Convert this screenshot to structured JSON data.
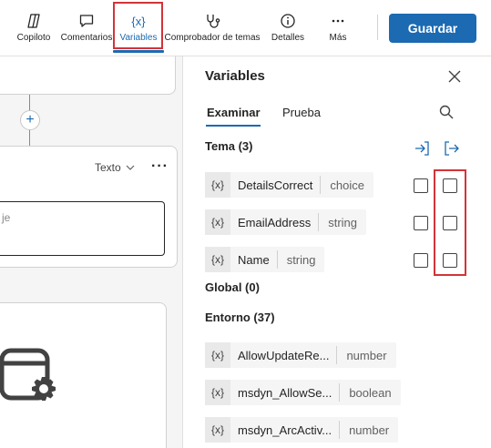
{
  "toolbar": {
    "items": [
      {
        "label": "Copiloto",
        "icon": "copilot-icon"
      },
      {
        "label": "Comentarios",
        "icon": "comment-icon"
      },
      {
        "label": "Variables",
        "icon": "variables-icon",
        "active": true
      },
      {
        "label": "Comprobador de temas",
        "icon": "stethoscope-icon"
      },
      {
        "label": "Detalles",
        "icon": "info-icon"
      },
      {
        "label": "Más",
        "icon": "more-icon"
      }
    ],
    "variables_icon_text": "{x}",
    "save_label": "Guardar"
  },
  "canvas": {
    "format_dropdown": "Texto",
    "message_placeholder": "je"
  },
  "panel": {
    "title": "Variables",
    "tabs": [
      "Examinar",
      "Prueba"
    ],
    "active_tab": "Examinar",
    "topic_section": "Tema (3)",
    "global_section": "Global (0)",
    "env_section": "Entorno (37)",
    "var_badge": "{x}",
    "topic_vars": [
      {
        "name": "DetailsCorrect",
        "type": "choice"
      },
      {
        "name": "EmailAddress",
        "type": "string"
      },
      {
        "name": "Name",
        "type": "string"
      }
    ],
    "env_vars": [
      {
        "name": "AllowUpdateRe...",
        "type": "number"
      },
      {
        "name": "msdyn_AllowSe...",
        "type": "boolean"
      },
      {
        "name": "msdyn_ArcActiv...",
        "type": "number"
      }
    ]
  },
  "colors": {
    "accent": "#1b6ab2",
    "highlight": "#d13438"
  }
}
